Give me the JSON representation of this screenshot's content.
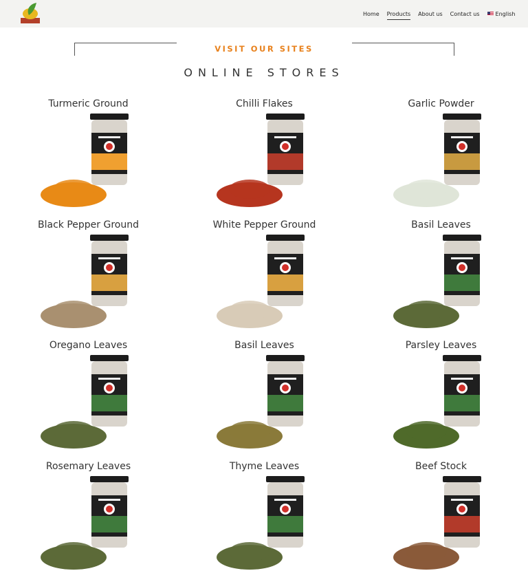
{
  "nav": {
    "items": [
      {
        "label": "Home",
        "active": false
      },
      {
        "label": "Products",
        "active": true
      },
      {
        "label": "About us",
        "active": false
      },
      {
        "label": "Contact us",
        "active": false
      }
    ],
    "language": "English"
  },
  "section": {
    "eyebrow": "VISIT OUR SITES",
    "title": "ONLINE STORES"
  },
  "products": [
    {
      "name": "Turmeric Ground",
      "label_color": "#f0a030",
      "pile_color": "#e88a16"
    },
    {
      "name": "Chilli Flakes",
      "label_color": "#b23a2a",
      "pile_color": "#b6351f"
    },
    {
      "name": "Garlic Powder",
      "label_color": "#c89a40",
      "pile_color": "#dfe5d8"
    },
    {
      "name": "Black Pepper Ground",
      "label_color": "#d8a040",
      "pile_color": "#a99070"
    },
    {
      "name": "White Pepper Ground",
      "label_color": "#d8a040",
      "pile_color": "#d8cbb7"
    },
    {
      "name": "Basil Leaves",
      "label_color": "#3f7a3c",
      "pile_color": "#5c6a38"
    },
    {
      "name": "Oregano Leaves",
      "label_color": "#3f7a3c",
      "pile_color": "#5c6a38"
    },
    {
      "name": "Basil Leaves",
      "label_color": "#3f7a3c",
      "pile_color": "#8a7a3a"
    },
    {
      "name": "Parsley Leaves",
      "label_color": "#3f7a3c",
      "pile_color": "#4f6a2a"
    },
    {
      "name": "Rosemary Leaves",
      "label_color": "#3f7a3c",
      "pile_color": "#5c6a38"
    },
    {
      "name": "Thyme Leaves",
      "label_color": "#3f7a3c",
      "pile_color": "#5c6a38"
    },
    {
      "name": "Beef Stock",
      "label_color": "#b23a2a",
      "pile_color": "#8a5a3a"
    }
  ]
}
